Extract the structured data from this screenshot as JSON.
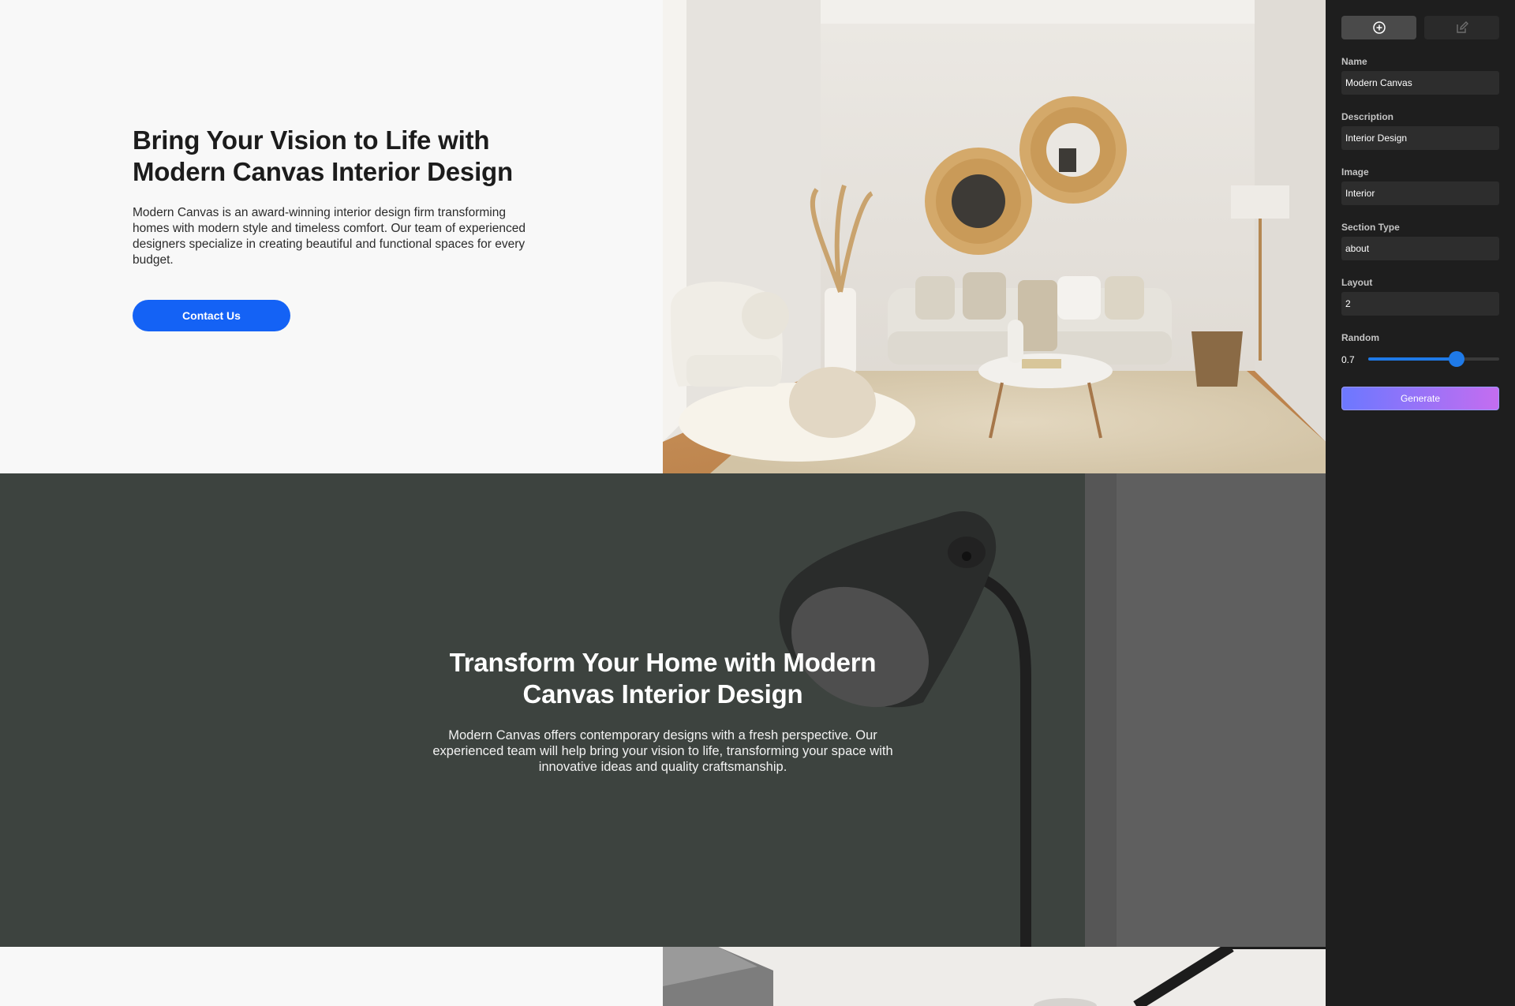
{
  "hero": {
    "title": "Bring Your Vision to Life with Modern Canvas Interior Design",
    "body": "Modern Canvas is an award-winning interior design firm transforming homes with modern style and timeless comfort. Our team of experienced designers specialize in creating beautiful and functional spaces for every budget.",
    "cta_label": "Contact Us",
    "image_desc": "living-room-photo"
  },
  "feature": {
    "title": "Transform Your Home with Modern Canvas Interior Design",
    "body": "Modern Canvas offers contemporary designs with a fresh perspective. Our experienced team will help bring your vision to life, transforming your space with innovative ideas and quality craftsmanship."
  },
  "panel": {
    "tabs": [
      {
        "icon": "add-circle-icon",
        "active": true
      },
      {
        "icon": "edit-icon",
        "active": false
      }
    ],
    "fields": {
      "name": {
        "label": "Name",
        "value": "Modern Canvas"
      },
      "description": {
        "label": "Description",
        "value": "Interior Design"
      },
      "image": {
        "label": "Image",
        "value": "Interior"
      },
      "section_type": {
        "label": "Section Type",
        "value": "about"
      },
      "layout": {
        "label": "Layout",
        "value": "2"
      }
    },
    "random": {
      "label": "Random",
      "value": "0.7",
      "fraction": 0.7
    },
    "generate_label": "Generate"
  },
  "colors": {
    "accent": "#1462f5",
    "slider": "#1f7ae8",
    "panel_bg": "#1e1e1e",
    "dark_section": "#3d433f"
  }
}
